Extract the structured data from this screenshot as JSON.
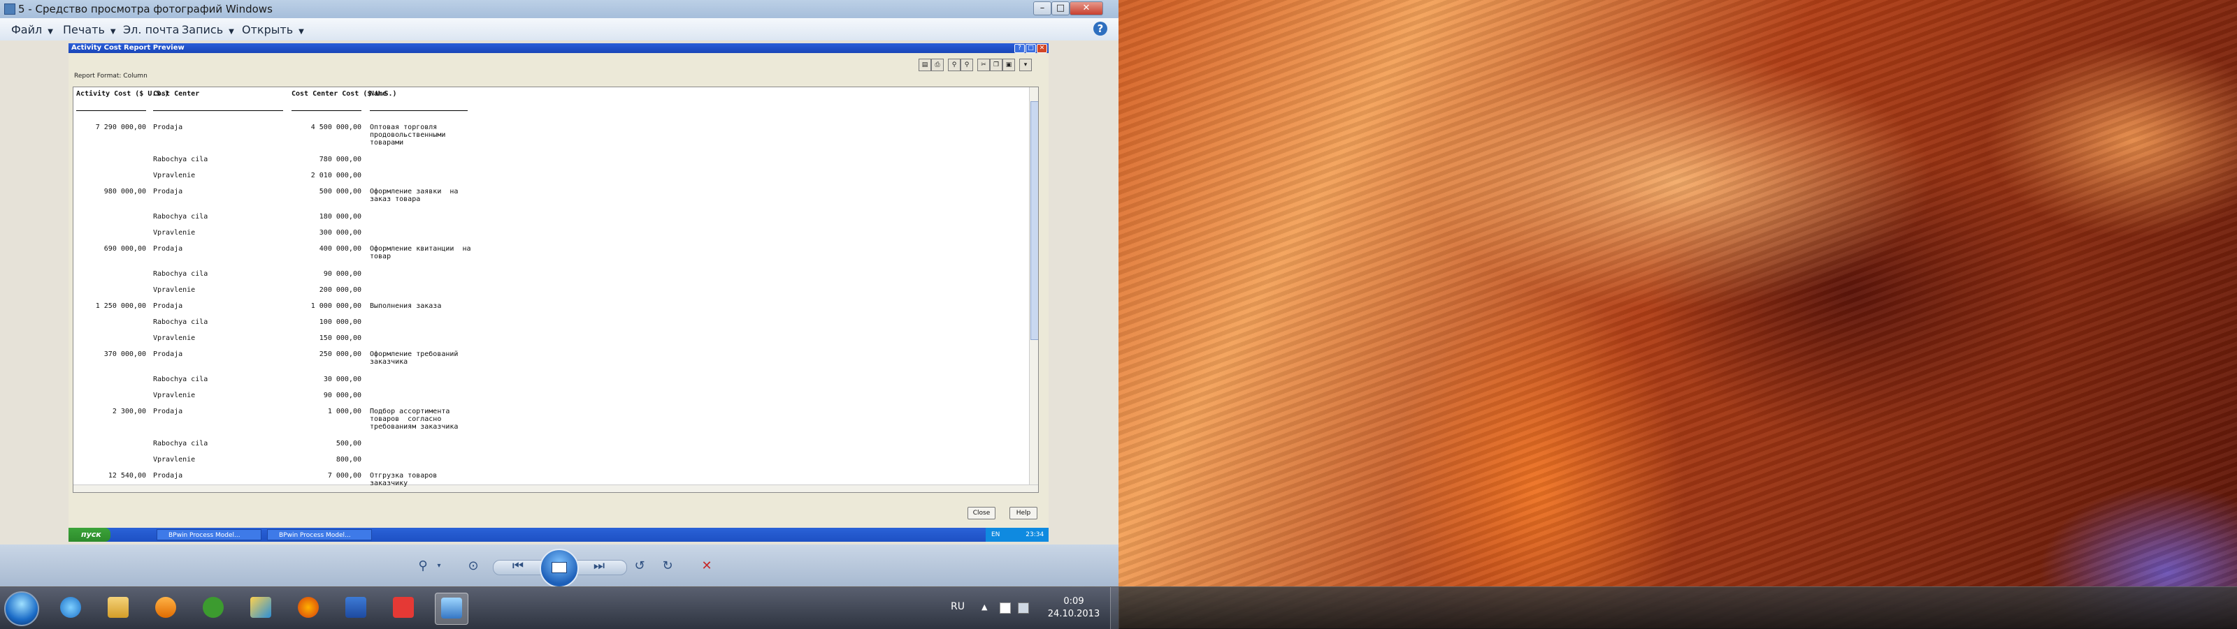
{
  "window": {
    "title": "5 - Средство просмотра фотографий Windows"
  },
  "menu": {
    "items": [
      "Файл",
      "Печать",
      "Эл. почта",
      "Запись",
      "Открыть"
    ]
  },
  "inner": {
    "title": "Activity Cost Report Preview",
    "report_format": "Report Format: Column",
    "columns": [
      "Activity Cost\n($ U.S.)",
      "Cost Center",
      "Cost Center Cost\n($ U.S.)",
      "Name"
    ],
    "rows": [
      {
        "activity": "7 290 000,00",
        "center": "Prodaja",
        "cost": "4 500 000,00",
        "name": "Оптовая торговля\nпродовольственными\nтоварами"
      },
      {
        "activity": "",
        "center": "Rabochya cila",
        "cost": "780 000,00",
        "name": ""
      },
      {
        "activity": "",
        "center": "Vpravlenie",
        "cost": "2 010 000,00",
        "name": ""
      },
      {
        "activity": "980 000,00",
        "center": "Prodaja",
        "cost": "500 000,00",
        "name": "Оформление заявки  на\nзаказ товара"
      },
      {
        "activity": "",
        "center": "Rabochya cila",
        "cost": "180 000,00",
        "name": ""
      },
      {
        "activity": "",
        "center": "Vpravlenie",
        "cost": "300 000,00",
        "name": ""
      },
      {
        "activity": "690 000,00",
        "center": "Prodaja",
        "cost": "400 000,00",
        "name": "Оформление квитанции  на\nтовар"
      },
      {
        "activity": "",
        "center": "Rabochya cila",
        "cost": "90 000,00",
        "name": ""
      },
      {
        "activity": "",
        "center": "Vpravlenie",
        "cost": "200 000,00",
        "name": ""
      },
      {
        "activity": "1 250 000,00",
        "center": "Prodaja",
        "cost": "1 000 000,00",
        "name": "Выполнения заказа"
      },
      {
        "activity": "",
        "center": "Rabochya cila",
        "cost": "100 000,00",
        "name": ""
      },
      {
        "activity": "",
        "center": "Vpravlenie",
        "cost": "150 000,00",
        "name": ""
      },
      {
        "activity": "370 000,00",
        "center": "Prodaja",
        "cost": "250 000,00",
        "name": "Оформление требований\nзаказчика"
      },
      {
        "activity": "",
        "center": "Rabochya cila",
        "cost": "30 000,00",
        "name": ""
      },
      {
        "activity": "",
        "center": "Vpravlenie",
        "cost": "90 000,00",
        "name": ""
      },
      {
        "activity": "2 300,00",
        "center": "Prodaja",
        "cost": "1 000,00",
        "name": "Подбор ассортимента\nтоваров  согласно\nтребованиям заказчика"
      },
      {
        "activity": "",
        "center": "Rabochya cila",
        "cost": "500,00",
        "name": ""
      },
      {
        "activity": "",
        "center": "Vpravlenie",
        "cost": "800,00",
        "name": ""
      },
      {
        "activity": "12 540,00",
        "center": "Prodaja",
        "cost": "7 000,00",
        "name": "Отгрузка товаров\nзаказчику"
      }
    ],
    "close_label": "Close",
    "help_label": "Help",
    "start_label": "пуск",
    "tasks": [
      "BPwin Process Model...",
      "BPwin Process Model..."
    ],
    "tray_lang": "EN",
    "tray_time": "23:34"
  },
  "taskbar": {
    "lang": "RU",
    "time": "0:09",
    "date": "24.10.2013"
  },
  "colors": {
    "xp_blue": "#1d50c4",
    "win7_frame": "#a6bedb"
  }
}
